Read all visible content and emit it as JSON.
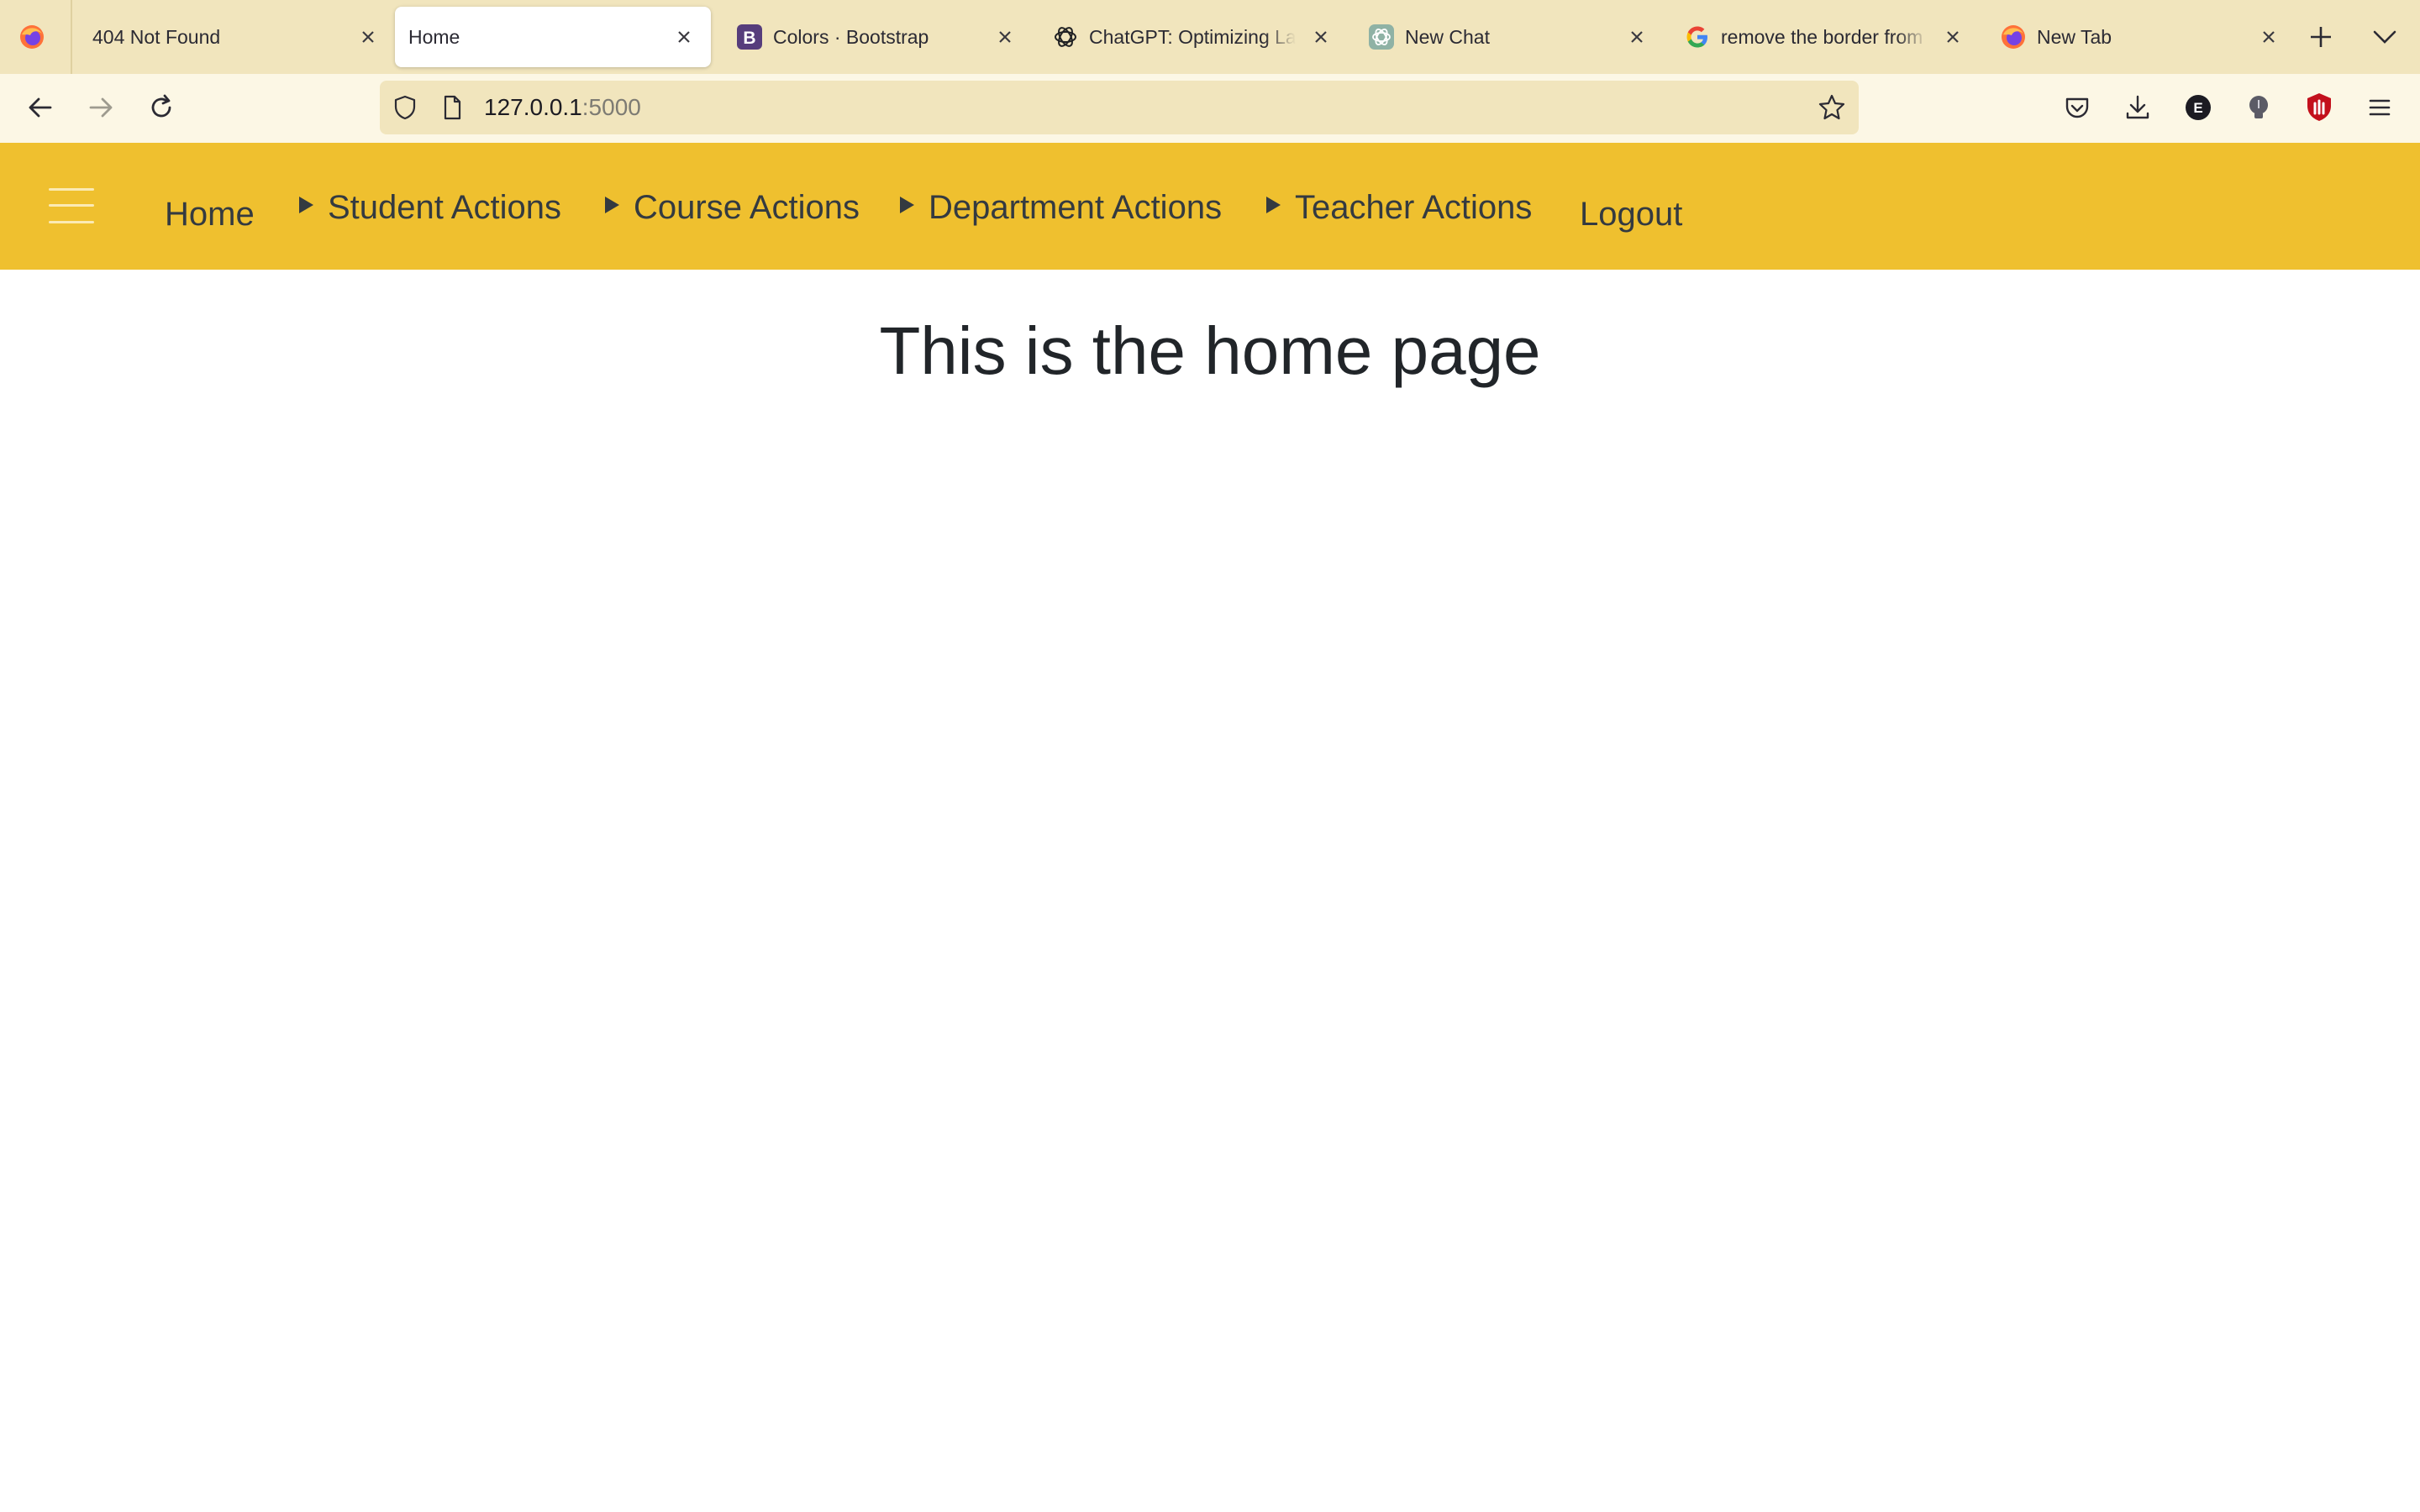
{
  "browser": {
    "tabs": [
      {
        "title": "404 Not Found",
        "favicon": "firefox-icon",
        "active": false
      },
      {
        "title": "Home",
        "favicon": "",
        "active": true
      },
      {
        "title": "Colors · Bootstrap",
        "favicon": "bootstrap-icon",
        "active": false
      },
      {
        "title": "ChatGPT: Optimizing Language Models",
        "favicon": "chatgpt-icon",
        "active": false
      },
      {
        "title": "New Chat",
        "favicon": "chatgpt-icon",
        "active": false
      },
      {
        "title": "remove the border from a",
        "favicon": "google-icon",
        "active": false
      },
      {
        "title": "New Tab",
        "favicon": "firefox-icon",
        "active": false
      }
    ],
    "url": {
      "host": "127.0.0.1",
      "port": ":5000"
    },
    "extension_badge": "E",
    "colors": {
      "tabstrip": "#f1e5bd",
      "toolbar": "#fcf7e5",
      "urlbar": "#f1e5bd"
    }
  },
  "site": {
    "nav": {
      "home": "Home",
      "student_actions": "Student Actions",
      "course_actions": "Course Actions",
      "department_actions": "Department Actions",
      "teacher_actions": "Teacher Actions",
      "logout": "Logout"
    },
    "heading": "This is the home page",
    "colors": {
      "navbar": "#efc02f",
      "text": "#343a40"
    }
  }
}
